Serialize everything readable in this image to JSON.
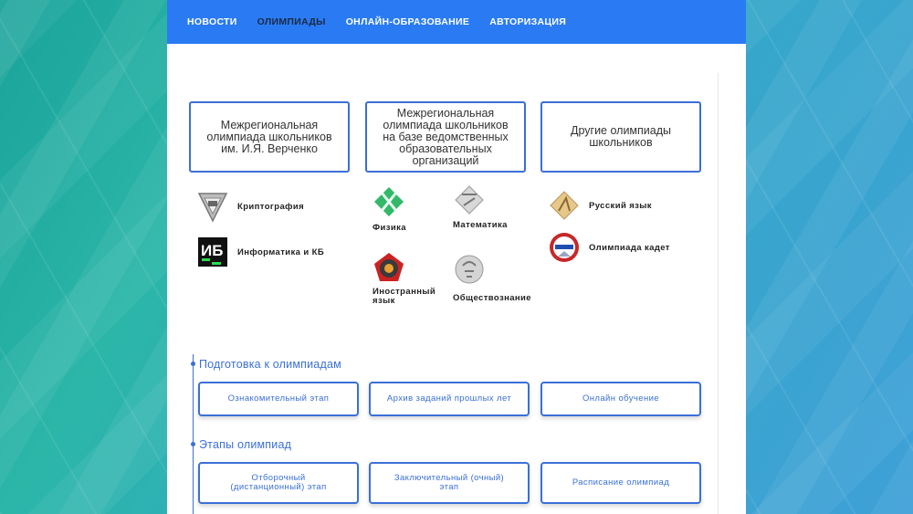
{
  "nav": {
    "items": [
      {
        "label": "НОВОСТИ"
      },
      {
        "label": "ОЛИМПИАДЫ"
      },
      {
        "label": "ОНЛАЙН-ОБРАЗОВАНИЕ"
      },
      {
        "label": "АВТОРИЗАЦИЯ"
      }
    ],
    "active_index": 1
  },
  "categories": [
    {
      "title": "Межрегиональная олимпиада школьников им. И.Я. Верченко"
    },
    {
      "title": "Межрегиональная олимпиада школьников на базе ведомственных образовательных организаций"
    },
    {
      "title": "Другие олимпиады школьников"
    }
  ],
  "olympiads": {
    "col1": [
      {
        "label": "Криптография",
        "icon": "cryptography-icon"
      },
      {
        "label": "Информатика и КБ",
        "icon": "informatics-icon"
      }
    ],
    "col2": [
      {
        "label": "Физика",
        "icon": "physics-icon"
      },
      {
        "label": "Математика",
        "icon": "math-icon"
      },
      {
        "label": "Иностранный язык",
        "icon": "foreign-language-icon"
      },
      {
        "label": "Обществознание",
        "icon": "social-studies-icon"
      }
    ],
    "col3": [
      {
        "label": "Русский язык",
        "icon": "russian-language-icon"
      },
      {
        "label": "Олимпиада кадет",
        "icon": "cadet-icon"
      }
    ]
  },
  "preparation": {
    "title": "Подготовка к олимпиадам",
    "buttons": [
      {
        "label": "Ознакомительный этап"
      },
      {
        "label": "Архив заданий прошлых лет"
      },
      {
        "label": "Онлайн обучение"
      }
    ]
  },
  "stages": {
    "title": "Этапы олимпиад",
    "buttons": [
      {
        "label": "Отборочный (дистанционный) этап"
      },
      {
        "label": "Заключительный (очный) этап"
      },
      {
        "label": "Расписание олимпиад"
      }
    ]
  },
  "colors": {
    "nav_bg": "#2a7bf3",
    "accent": "#3b6fd8",
    "nav_active": "#1a2a44"
  }
}
